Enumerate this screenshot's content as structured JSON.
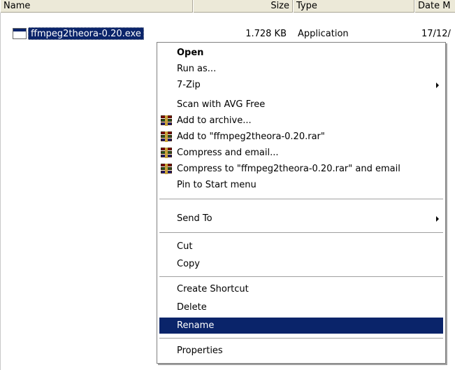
{
  "columns": {
    "name": "Name",
    "size": "Size",
    "type": "Type",
    "date": "Date M"
  },
  "file": {
    "name": "ffmpeg2theora-0.20.exe",
    "size": "1.728 KB",
    "type": "Application",
    "date": "17/12/"
  },
  "menu": {
    "open": "Open",
    "run_as": "Run as...",
    "seven_zip": "7-Zip",
    "scan": "Scan with AVG Free",
    "add_archive": "Add to archive...",
    "add_to_rar": "Add to \"ffmpeg2theora-0.20.rar\"",
    "compress_email": "Compress and email...",
    "compress_to_rar_email": "Compress to \"ffmpeg2theora-0.20.rar\" and email",
    "pin_start": "Pin to Start menu",
    "send_to": "Send To",
    "cut": "Cut",
    "copy": "Copy",
    "create_shortcut": "Create Shortcut",
    "delete": "Delete",
    "rename": "Rename",
    "properties": "Properties"
  },
  "icons": {
    "file": "application-exe-icon",
    "archive": "winrar-archive-icon",
    "submenu": "submenu-arrow-icon"
  },
  "colors": {
    "selection": "#0a246a",
    "header_bg": "#ece9d8"
  }
}
